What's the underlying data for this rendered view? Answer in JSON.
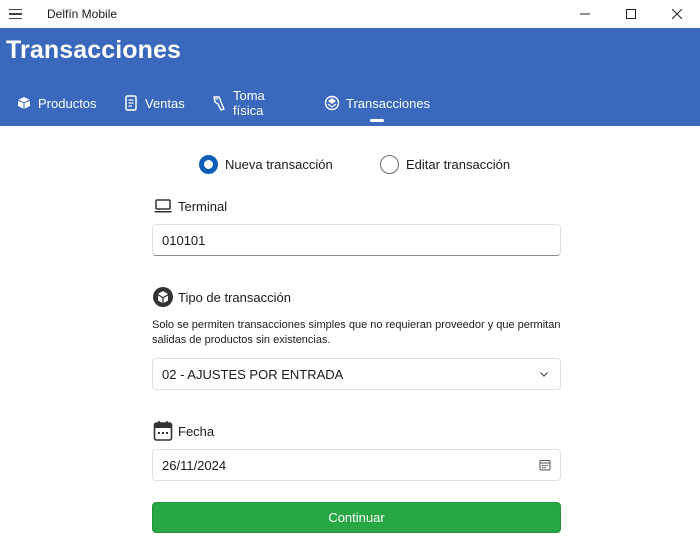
{
  "window": {
    "app_title": "Delfín Mobile"
  },
  "header": {
    "page_title": "Transacciones",
    "tabs": [
      {
        "label": "Productos",
        "icon": "box-icon",
        "active": false
      },
      {
        "label": "Ventas",
        "icon": "receipt-icon",
        "active": false
      },
      {
        "label": "Toma física",
        "icon": "hand-scanner-icon",
        "active": false
      },
      {
        "label": "Transacciones",
        "icon": "exchange-icon",
        "active": true
      }
    ]
  },
  "mode": {
    "options": [
      {
        "label": "Nueva transacción",
        "selected": true
      },
      {
        "label": "Editar transacción",
        "selected": false
      }
    ]
  },
  "terminal": {
    "label": "Terminal",
    "icon": "laptop-icon",
    "value": "010101"
  },
  "transaction_type": {
    "label": "Tipo de transacción",
    "icon": "boxes-icon",
    "help": "Solo se permiten transacciones simples que no requieran proveedor  y que permitan salidas de productos sin existencias.",
    "selected": "02 - AJUSTES POR ENTRADA"
  },
  "date": {
    "label": "Fecha",
    "icon": "calendar-icon",
    "value": "26/11/2024"
  },
  "actions": {
    "continue_label": "Continuar"
  },
  "colors": {
    "header_bg": "#3a68bd",
    "radio_accent": "#0f5fb7",
    "continue_bg": "#28a745"
  }
}
